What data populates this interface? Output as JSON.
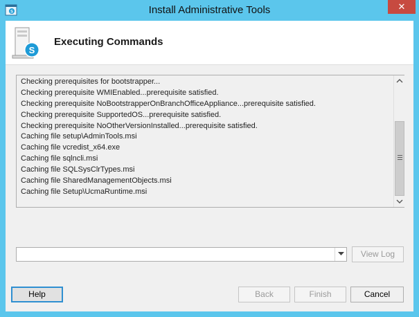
{
  "window": {
    "title": "Install Administrative Tools",
    "close_glyph": "✕"
  },
  "header": {
    "title": "Executing Commands",
    "icon": "skype-server-icon"
  },
  "log": {
    "lines": [
      "Checking prerequisites for bootstrapper...",
      "Checking prerequisite WMIEnabled...prerequisite satisfied.",
      "Checking prerequisite NoBootstrapperOnBranchOfficeAppliance...prerequisite satisfied.",
      "Checking prerequisite SupportedOS...prerequisite satisfied.",
      "Checking prerequisite NoOtherVersionInstalled...prerequisite satisfied.",
      "Caching file setup\\AdminTools.msi",
      "Caching file vcredist_x64.exe",
      "Caching file sqlncli.msi",
      "Caching file SQLSysClrTypes.msi",
      "Caching file SharedManagementObjects.msi",
      "Caching file Setup\\UcmaRuntime.msi"
    ]
  },
  "combo": {
    "value": ""
  },
  "buttons": {
    "view_log": "View Log",
    "help": "Help",
    "back": "Back",
    "finish": "Finish",
    "cancel": "Cancel"
  }
}
